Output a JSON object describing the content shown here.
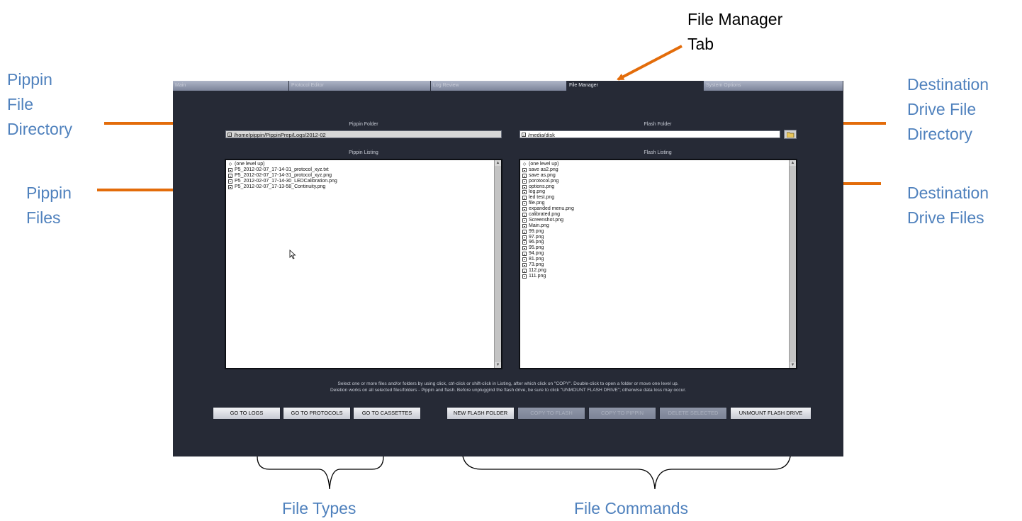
{
  "callouts": {
    "file_manager_tab": "File Manager\nTab",
    "pippin_file_directory": "Pippin\nFile\nDirectory",
    "pippin_files": "Pippin\nFiles",
    "destination_drive_file_directory": "Destination\nDrive File\nDirectory",
    "destination_drive_files": "Destination\nDrive Files",
    "file_types": "File Types",
    "file_commands": "File Commands"
  },
  "tabs": [
    {
      "label": "Main"
    },
    {
      "label": "Protocol Editor"
    },
    {
      "label": "Log Review"
    },
    {
      "label": "File Manager",
      "active": true
    },
    {
      "label": "System Options"
    }
  ],
  "pippin": {
    "folder_label": "Pippin Folder",
    "folder_path": "/home/pippin/PippinPrep/Logs/2012-02",
    "listing_label": "Pippin Listing",
    "items": [
      {
        "name": "(one level up)",
        "icon": "up-diamond-icon"
      },
      {
        "name": "P5_2012-02-07_17-14-31_protocol_xyz.txt",
        "icon": "file-icon"
      },
      {
        "name": "P5_2012-02-07_17-14-31_protocol_xyz.png",
        "icon": "image-file-icon"
      },
      {
        "name": "P5_2012-02-07_17-14-30_LEDCalibration.png",
        "icon": "image-file-icon"
      },
      {
        "name": "P5_2012-02-07_17-13-58_Continuity.png",
        "icon": "image-file-icon"
      }
    ]
  },
  "flash": {
    "folder_label": "Flash Folder",
    "folder_path": "/media/disk",
    "listing_label": "Flash Listing",
    "items": [
      {
        "name": "(one level up)",
        "icon": "up-diamond-icon"
      },
      {
        "name": "save as2.png",
        "icon": "image-file-icon"
      },
      {
        "name": "save as.png",
        "icon": "image-file-icon"
      },
      {
        "name": "porotocol.png",
        "icon": "image-file-icon"
      },
      {
        "name": "options.png",
        "icon": "image-file-icon"
      },
      {
        "name": "log.png",
        "icon": "image-file-icon"
      },
      {
        "name": "led test.png",
        "icon": "image-file-icon"
      },
      {
        "name": "file.png",
        "icon": "image-file-icon"
      },
      {
        "name": "expanded menu.png",
        "icon": "image-file-icon"
      },
      {
        "name": "calibrated.png",
        "icon": "image-file-icon"
      },
      {
        "name": "Screenshot.png",
        "icon": "image-file-icon"
      },
      {
        "name": "Main.png",
        "icon": "image-file-icon"
      },
      {
        "name": "99.png",
        "icon": "image-file-icon"
      },
      {
        "name": "97.png",
        "icon": "image-file-icon"
      },
      {
        "name": "96.png",
        "icon": "image-file-icon"
      },
      {
        "name": "95.png",
        "icon": "image-file-icon"
      },
      {
        "name": "94.png",
        "icon": "image-file-icon"
      },
      {
        "name": "81.png",
        "icon": "image-file-icon"
      },
      {
        "name": "73.png",
        "icon": "image-file-icon"
      },
      {
        "name": "112.png",
        "icon": "image-file-icon"
      },
      {
        "name": "111.png",
        "icon": "image-file-icon"
      }
    ]
  },
  "help": {
    "line1": "Select one or more files and/or folders by using click, ctrl-click or shift-click in Listing, after which click on \"COPY\". Double-click to open a folder or move one level up.",
    "line2": "Deletion works on all selected files/folders - Pippin and flash. Before unpluggind the flash drive, be sure to click \"UNMOUNT FLASH DRIVE\"; otherwise data loss may occur."
  },
  "buttons": {
    "go_to_logs": "GO TO LOGS",
    "go_to_protocols": "GO TO PROTOCOLS",
    "go_to_cassettes": "GO TO CASSETTES",
    "new_flash_folder": "NEW FLASH FOLDER",
    "copy_to_flash": "COPY TO FLASH",
    "copy_to_pippin": "COPY TO PIPPIN",
    "delete_selected": "DELETE SELECTED",
    "unmount_flash_drive": "UNMOUNT FLASH DRIVE"
  },
  "colors": {
    "callout_text": "#4f81bd",
    "arrow": "#e36c0a",
    "app_background": "#262a36"
  }
}
